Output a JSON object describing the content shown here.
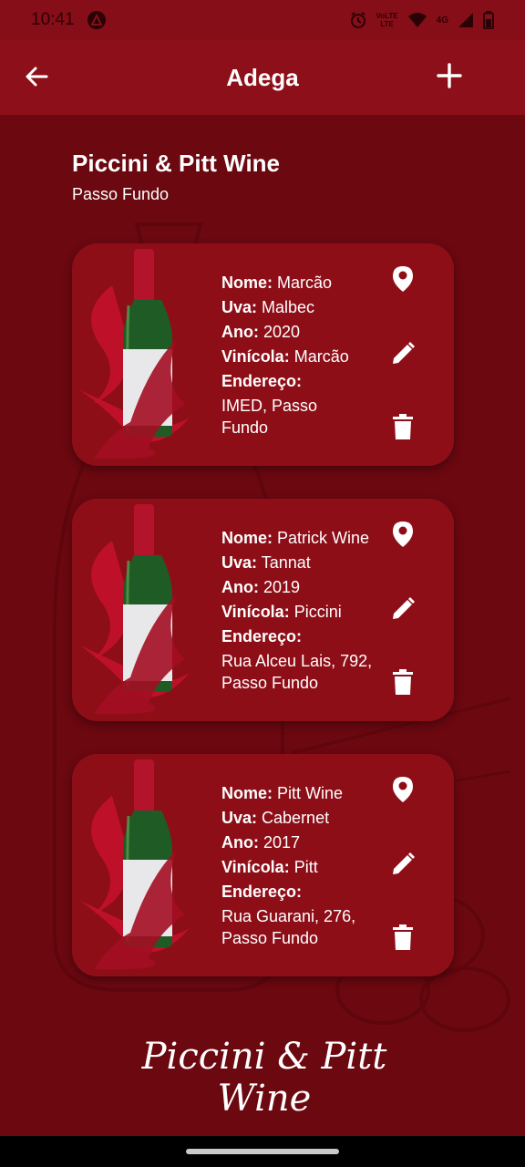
{
  "status_bar": {
    "time": "10:41",
    "network_label_top": "VoLTE",
    "network_label_bottom": "LTE",
    "cell_label": "4G"
  },
  "app_bar": {
    "title": "Adega",
    "back_icon": "arrow-left-icon",
    "add_icon": "plus-icon"
  },
  "store": {
    "name": "Piccini & Pitt Wine",
    "city": "Passo Fundo"
  },
  "labels": {
    "name": "Nome:",
    "grape": "Uva:",
    "year": "Ano:",
    "winery": "Vinícola:",
    "address": "Endereço:"
  },
  "wines": [
    {
      "name": "Marcão",
      "grape": "Malbec",
      "year": "2020",
      "winery": "Marcão",
      "address": "IMED, Passo Fundo"
    },
    {
      "name": "Patrick Wine",
      "grape": "Tannat",
      "year": "2019",
      "winery": "Piccini",
      "address": "Rua Alceu Lais, 792, Passo Fundo"
    },
    {
      "name": "Pitt Wine",
      "grape": "Cabernet",
      "year": "2017",
      "winery": "Pitt",
      "address": "Rua Guarani, 276, Passo Fundo"
    }
  ],
  "icons": {
    "map": "map-pin-icon",
    "edit": "pencil-icon",
    "delete": "trash-icon"
  },
  "brand": {
    "line1": "Piccini & Pitt",
    "line2": "Wine"
  },
  "colors": {
    "background": "#6b0810",
    "app_bar": "#8d0f19",
    "card": "#8e0e18",
    "text": "#ffffff"
  }
}
